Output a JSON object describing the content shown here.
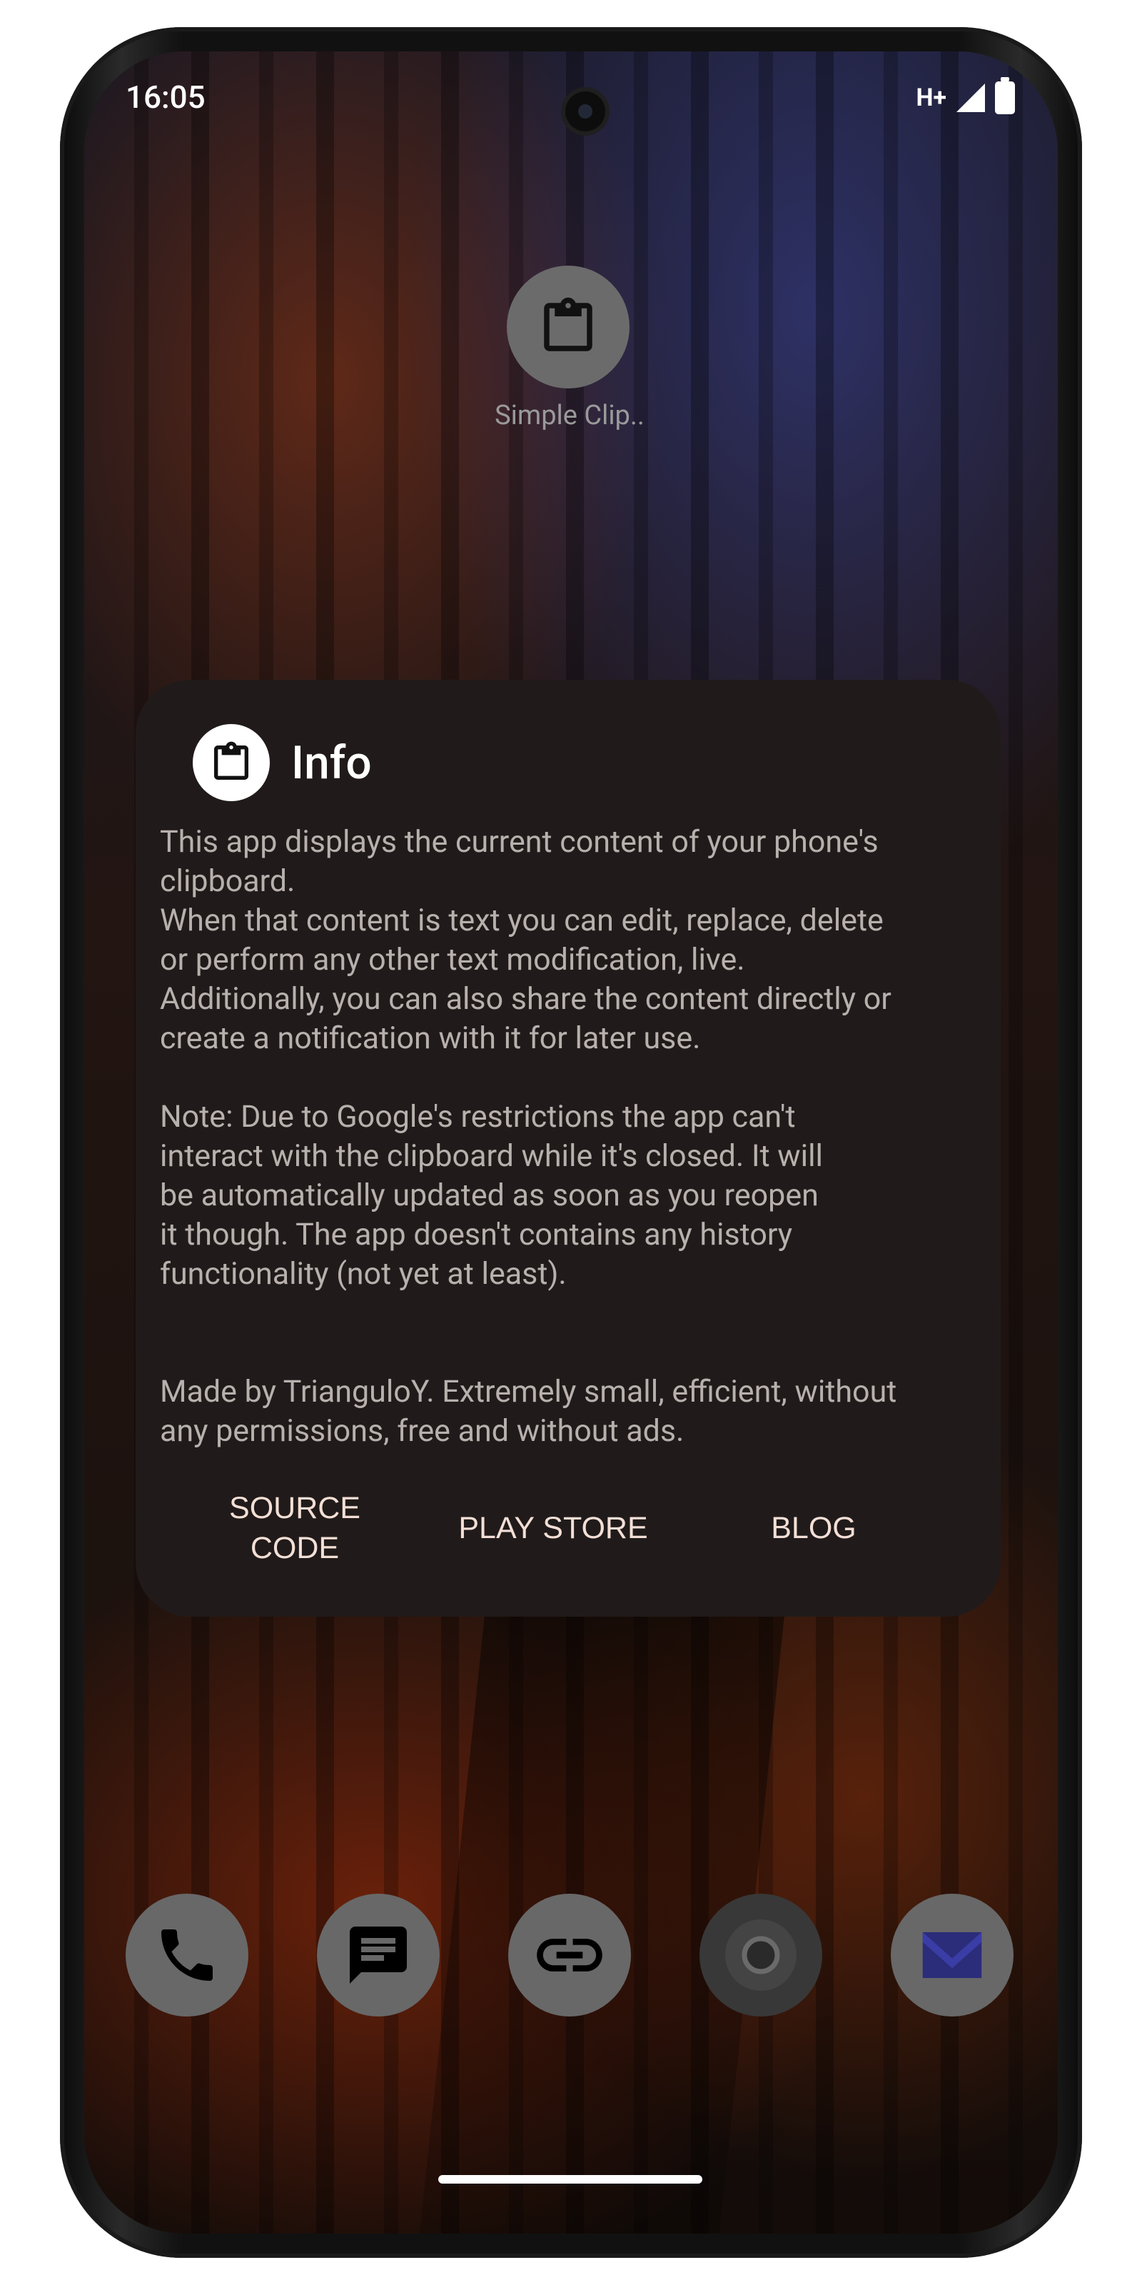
{
  "status_bar": {
    "time": "16:05",
    "network_type": "H+",
    "icons": [
      "signal-icon",
      "battery-icon"
    ]
  },
  "home": {
    "app_label": "Simple Clip..",
    "app_icon": "clipboard-icon",
    "dock": [
      "phone-icon",
      "messages-icon",
      "link-icon",
      "chrome-icon",
      "mail-icon"
    ]
  },
  "dialog": {
    "icon": "clipboard-icon",
    "title": "Info",
    "paragraph1": [
      "This app displays the current content of your phone's",
      "clipboard.",
      "When that content is text you can edit, replace, delete",
      "or perform any other text modification, live.",
      "Additionally, you can also share the content directly or",
      "create a notification with it for later use."
    ],
    "paragraph2": [
      "Note: Due to Google's restrictions the app can't",
      "interact with the clipboard while it's closed. It will",
      "be automatically updated as soon as you reopen",
      "it though. The app doesn't contains any history",
      "functionality (not yet at least)."
    ],
    "paragraph3": [
      "Made by TrianguloY. Extremely small, efficient, without",
      "any permissions, free and without ads."
    ],
    "actions": {
      "source_line1": "SOURCE",
      "source_line2": "CODE",
      "play_store": "PLAY STORE",
      "blog": "BLOG"
    }
  },
  "colors": {
    "dialog_bg": "#201b1a",
    "dialog_text": "#b8b0ad",
    "action_text": "#f3dfd6",
    "icon_bg": "#686868"
  }
}
